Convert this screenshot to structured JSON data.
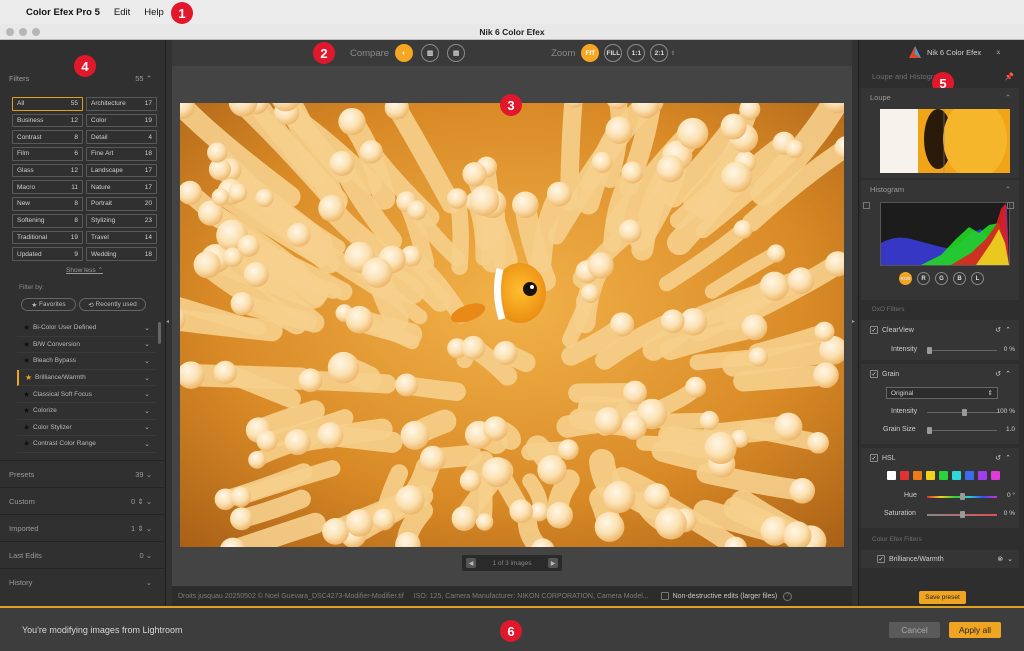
{
  "menubar": {
    "app_name": "Color Efex Pro 5",
    "menus": [
      "Edit",
      "Help"
    ]
  },
  "window": {
    "title": "Nik 6 Color Efex"
  },
  "callouts": [
    "1",
    "2",
    "3",
    "4",
    "5",
    "6"
  ],
  "toolbar": {
    "compare_label": "Compare",
    "zoom_label": "Zoom",
    "zoom_options": [
      "FIT",
      "FILL",
      "1:1",
      "2:1"
    ],
    "zoom_selected": "FIT"
  },
  "filters": {
    "header": "Filters",
    "count": "55",
    "categories": [
      {
        "name": "All",
        "count": "55",
        "selected": true
      },
      {
        "name": "Architecture",
        "count": "17"
      },
      {
        "name": "Business",
        "count": "12"
      },
      {
        "name": "Color",
        "count": "19"
      },
      {
        "name": "Contrast",
        "count": "8"
      },
      {
        "name": "Detail",
        "count": "4"
      },
      {
        "name": "Film",
        "count": "6"
      },
      {
        "name": "Fine Art",
        "count": "18"
      },
      {
        "name": "Glass",
        "count": "12"
      },
      {
        "name": "Landscape",
        "count": "17"
      },
      {
        "name": "Macro",
        "count": "11"
      },
      {
        "name": "Nature",
        "count": "17"
      },
      {
        "name": "New",
        "count": "8"
      },
      {
        "name": "Portrait",
        "count": "20"
      },
      {
        "name": "Softening",
        "count": "8"
      },
      {
        "name": "Stylizing",
        "count": "23"
      },
      {
        "name": "Traditional",
        "count": "19"
      },
      {
        "name": "Travel",
        "count": "14"
      },
      {
        "name": "Updated",
        "count": "9"
      },
      {
        "name": "Wedding",
        "count": "18"
      }
    ],
    "show_less": "Show less",
    "filter_by": "Filter by:",
    "favorites": "Favorites",
    "recently_used": "Recently used",
    "list": [
      "Bi-Color User Defined",
      "B/W Conversion",
      "Bleach Bypass",
      "Brilliance/Warmth",
      "Classical Soft Focus",
      "Colorize",
      "Color Stylizer",
      "Contrast Color Range"
    ],
    "active_item": "Brilliance/Warmth"
  },
  "left_sections": [
    {
      "label": "Presets",
      "count": "39"
    },
    {
      "label": "Custom",
      "count": "0"
    },
    {
      "label": "Imported",
      "count": "1"
    },
    {
      "label": "Last Edits",
      "count": "0"
    },
    {
      "label": "History",
      "count": ""
    }
  ],
  "navigator": {
    "text": "1 of 3 images"
  },
  "infobar": {
    "file": "Droits jusquau 20250502 © Noel Guevara_DSC4273-Modifier-Modifier.tif",
    "meta": "ISO: 125, Camera Manufacturer: NIKON CORPORATION, Camera Model...",
    "nondestructive": "Non-destructive edits (larger files)"
  },
  "right": {
    "brand": "Nik 6 Color Efex",
    "loupe_hist_header": "Loupe and Histogram",
    "loupe_label": "Loupe",
    "histogram_label": "Histogram",
    "channels": [
      "RGB",
      "R",
      "G",
      "B",
      "L"
    ],
    "dxo_header": "DxO Filters",
    "clearview": {
      "label": "ClearView",
      "intensity_label": "Intensity",
      "intensity_value": "0 %",
      "intensity": 0
    },
    "grain": {
      "label": "Grain",
      "preset": "Original",
      "intensity_label": "Intensity",
      "intensity_value": "100 %",
      "intensity": 1.0,
      "size_label": "Grain Size",
      "size_value": "1.0"
    },
    "hsl": {
      "label": "HSL",
      "swatches": [
        "#ffffff",
        "#e53030",
        "#f07a18",
        "#f2d21a",
        "#2bd33a",
        "#2fd8d8",
        "#3b6cf0",
        "#a23cf0",
        "#e03ad8"
      ],
      "hue_label": "Hue",
      "hue_value": "0 °",
      "sat_label": "Saturation",
      "sat_value": "0 %"
    },
    "cef_header": "Color Efex Filters",
    "cef_item": "Brilliance/Warmth",
    "save_preset": "Save preset"
  },
  "bottom": {
    "message": "You're modifying images from Lightroom",
    "cancel": "Cancel",
    "apply": "Apply all"
  }
}
